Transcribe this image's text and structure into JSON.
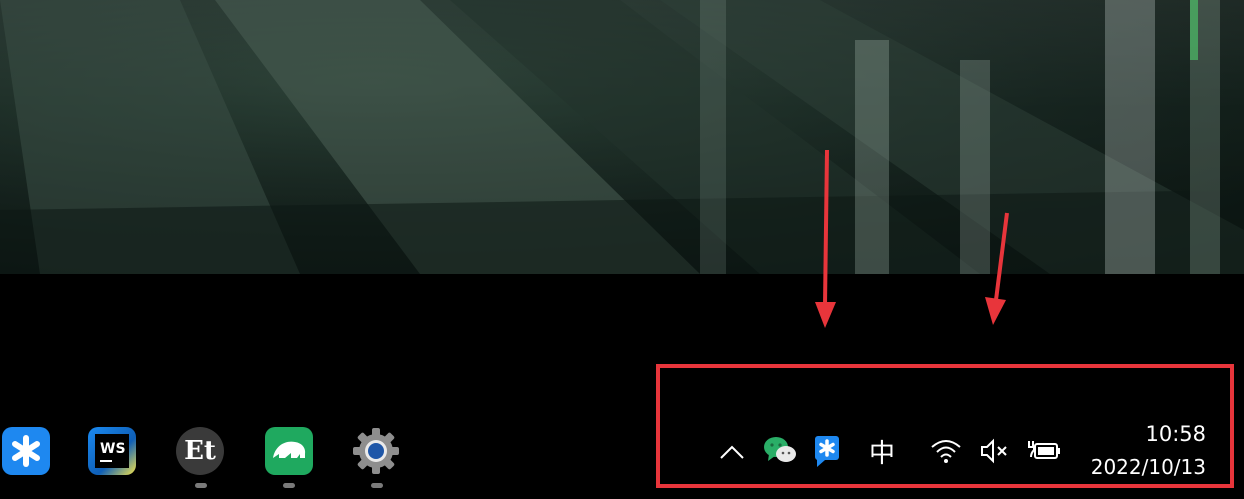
{
  "taskbar": {
    "apps": [
      {
        "name": "Lark Feishu",
        "icon": "lark-asterisk-icon",
        "running": false
      },
      {
        "name": "WebStorm",
        "icon": "webstorm-icon",
        "label": "WS",
        "running": false
      },
      {
        "name": "Everything",
        "icon": "everything-icon",
        "label": "Et",
        "running": true
      },
      {
        "name": "Axure",
        "icon": "green-animal-icon",
        "running": true
      },
      {
        "name": "Settings",
        "icon": "gear-icon",
        "running": true
      }
    ]
  },
  "tray": {
    "chevron_icon": "chevron-up-icon",
    "wechat_icon": "wechat-icon",
    "lark_icon": "lark-asterisk-icon",
    "ime_label": "中",
    "wifi_icon": "wifi-icon",
    "volume_icon": "volume-muted-icon",
    "battery_icon": "battery-charging-icon",
    "time": "10:58",
    "date": "2022/10/13"
  },
  "colors": {
    "highlight": "#e8353b",
    "lark_blue": "#1e88f0",
    "wechat_green": "#2aae67",
    "axure_green": "#1fa95f"
  }
}
